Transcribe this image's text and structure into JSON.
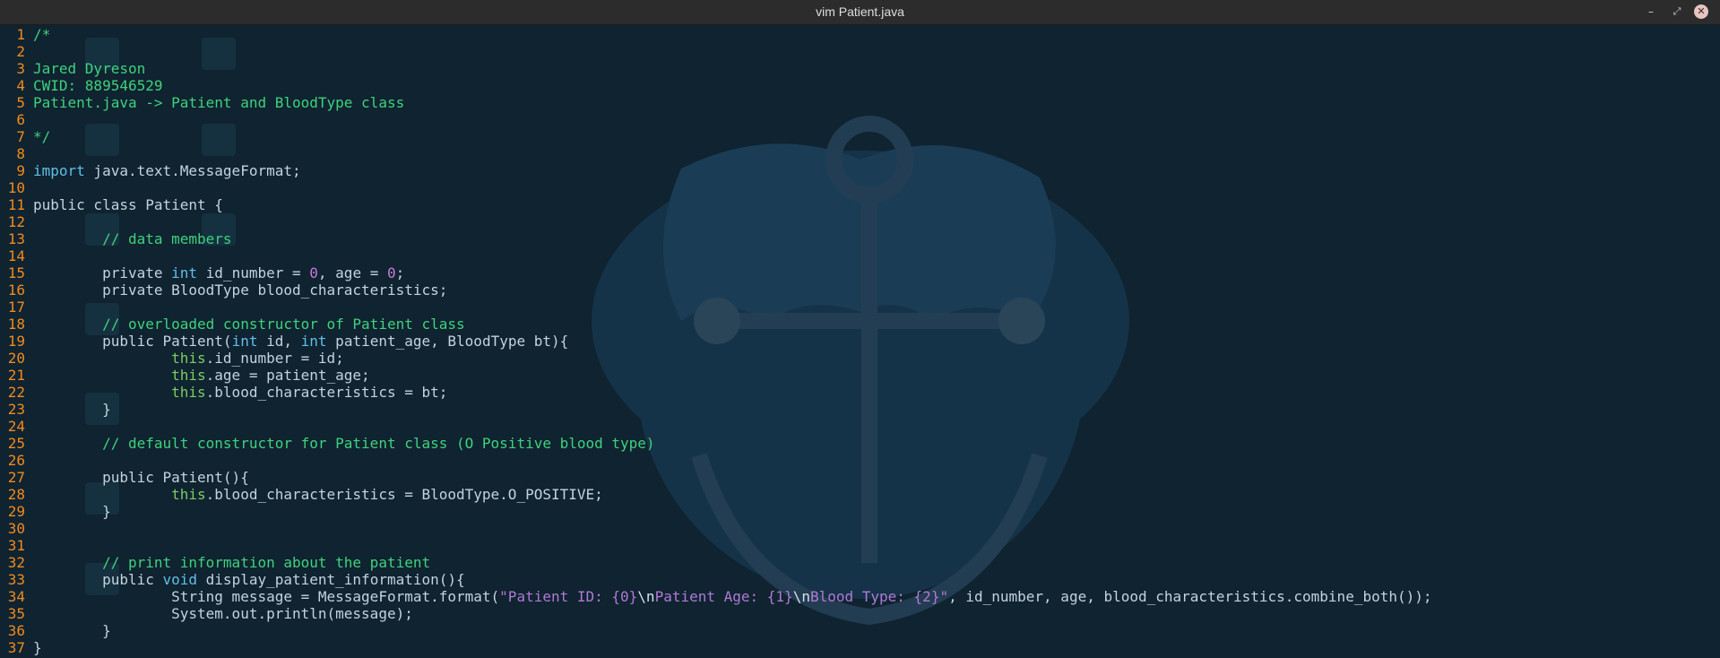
{
  "window": {
    "title": "vim Patient.java",
    "controls": {
      "minimize": "–",
      "maximize": "⤢",
      "close": "✕"
    }
  },
  "colors": {
    "background": "#0f2330",
    "titlebar": "#2c2c2c",
    "line_number": "#f28a1d",
    "comment": "#3fd27d",
    "keyword": "#61bfe8",
    "type": "#7ecb62",
    "string": "#b079d6",
    "number": "#c77bd8",
    "plain": "#c3d3de"
  },
  "editor": {
    "lines": [
      {
        "n": "1",
        "tokens": [
          {
            "t": "/*",
            "k": "comment"
          }
        ]
      },
      {
        "n": "2",
        "tokens": []
      },
      {
        "n": "3",
        "tokens": [
          {
            "t": "Jared Dyreson",
            "k": "comment"
          }
        ]
      },
      {
        "n": "4",
        "tokens": [
          {
            "t": "CWID: 889546529",
            "k": "comment"
          }
        ]
      },
      {
        "n": "5",
        "tokens": [
          {
            "t": "Patient.java -> Patient and BloodType class",
            "k": "comment"
          }
        ]
      },
      {
        "n": "6",
        "tokens": []
      },
      {
        "n": "7",
        "tokens": [
          {
            "t": "*/",
            "k": "comment"
          }
        ]
      },
      {
        "n": "8",
        "tokens": []
      },
      {
        "n": "9",
        "tokens": [
          {
            "t": "import",
            "k": "keyword"
          },
          {
            "t": " java.text.MessageFormat;",
            "k": "plain"
          }
        ]
      },
      {
        "n": "10",
        "tokens": []
      },
      {
        "n": "11",
        "tokens": [
          {
            "t": "public class Patient {",
            "k": "plain"
          }
        ]
      },
      {
        "n": "12",
        "tokens": []
      },
      {
        "n": "13",
        "tokens": [
          {
            "t": "        ",
            "k": "plain"
          },
          {
            "t": "// data members",
            "k": "comment"
          }
        ]
      },
      {
        "n": "14",
        "tokens": []
      },
      {
        "n": "15",
        "tokens": [
          {
            "t": "        private ",
            "k": "plain"
          },
          {
            "t": "int",
            "k": "keyword"
          },
          {
            "t": " id_number = ",
            "k": "plain"
          },
          {
            "t": "0",
            "k": "number"
          },
          {
            "t": ", age = ",
            "k": "plain"
          },
          {
            "t": "0",
            "k": "number"
          },
          {
            "t": ";",
            "k": "plain"
          }
        ]
      },
      {
        "n": "16",
        "tokens": [
          {
            "t": "        private BloodType blood_characteristics;",
            "k": "plain"
          }
        ]
      },
      {
        "n": "17",
        "tokens": []
      },
      {
        "n": "18",
        "tokens": [
          {
            "t": "        ",
            "k": "plain"
          },
          {
            "t": "// overloaded constructor of Patient class",
            "k": "comment"
          }
        ]
      },
      {
        "n": "19",
        "tokens": [
          {
            "t": "        public Patient(",
            "k": "plain"
          },
          {
            "t": "int",
            "k": "keyword"
          },
          {
            "t": " id, ",
            "k": "plain"
          },
          {
            "t": "int",
            "k": "keyword"
          },
          {
            "t": " patient_age, BloodType bt){",
            "k": "plain"
          }
        ]
      },
      {
        "n": "20",
        "tokens": [
          {
            "t": "                ",
            "k": "plain"
          },
          {
            "t": "this",
            "k": "type"
          },
          {
            "t": ".id_number = id;",
            "k": "plain"
          }
        ]
      },
      {
        "n": "21",
        "tokens": [
          {
            "t": "                ",
            "k": "plain"
          },
          {
            "t": "this",
            "k": "type"
          },
          {
            "t": ".age = patient_age;",
            "k": "plain"
          }
        ]
      },
      {
        "n": "22",
        "tokens": [
          {
            "t": "                ",
            "k": "plain"
          },
          {
            "t": "this",
            "k": "type"
          },
          {
            "t": ".blood_characteristics = bt;",
            "k": "plain"
          }
        ]
      },
      {
        "n": "23",
        "tokens": [
          {
            "t": "        }",
            "k": "plain"
          }
        ]
      },
      {
        "n": "24",
        "tokens": []
      },
      {
        "n": "25",
        "tokens": [
          {
            "t": "        ",
            "k": "plain"
          },
          {
            "t": "// default constructor for Patient class (O Positive blood type)",
            "k": "comment"
          }
        ]
      },
      {
        "n": "26",
        "tokens": []
      },
      {
        "n": "27",
        "tokens": [
          {
            "t": "        public Patient(){",
            "k": "plain"
          }
        ]
      },
      {
        "n": "28",
        "tokens": [
          {
            "t": "                ",
            "k": "plain"
          },
          {
            "t": "this",
            "k": "type"
          },
          {
            "t": ".blood_characteristics = BloodType.O_POSITIVE;",
            "k": "plain"
          }
        ]
      },
      {
        "n": "29",
        "tokens": [
          {
            "t": "        }",
            "k": "plain"
          }
        ]
      },
      {
        "n": "30",
        "tokens": []
      },
      {
        "n": "31",
        "tokens": []
      },
      {
        "n": "32",
        "tokens": [
          {
            "t": "        ",
            "k": "plain"
          },
          {
            "t": "// print information about the patient",
            "k": "comment"
          }
        ]
      },
      {
        "n": "33",
        "tokens": [
          {
            "t": "        public ",
            "k": "plain"
          },
          {
            "t": "void",
            "k": "keyword"
          },
          {
            "t": " display_patient_information(){",
            "k": "plain"
          }
        ]
      },
      {
        "n": "34",
        "tokens": [
          {
            "t": "                String message = MessageFormat.format(",
            "k": "plain"
          },
          {
            "t": "\"Patient ID: {0}",
            "k": "string"
          },
          {
            "t": "\\n",
            "k": "special"
          },
          {
            "t": "Patient Age: {1}",
            "k": "string"
          },
          {
            "t": "\\n",
            "k": "special"
          },
          {
            "t": "Blood Type: {2}\"",
            "k": "string"
          },
          {
            "t": ", id_number, age, blood_characteristics.combine_both());",
            "k": "plain"
          }
        ]
      },
      {
        "n": "35",
        "tokens": [
          {
            "t": "                System.out.println(message);",
            "k": "plain"
          }
        ]
      },
      {
        "n": "36",
        "tokens": [
          {
            "t": "        }",
            "k": "plain"
          }
        ]
      },
      {
        "n": "37",
        "tokens": [
          {
            "t": "}",
            "k": "plain"
          }
        ]
      }
    ]
  }
}
